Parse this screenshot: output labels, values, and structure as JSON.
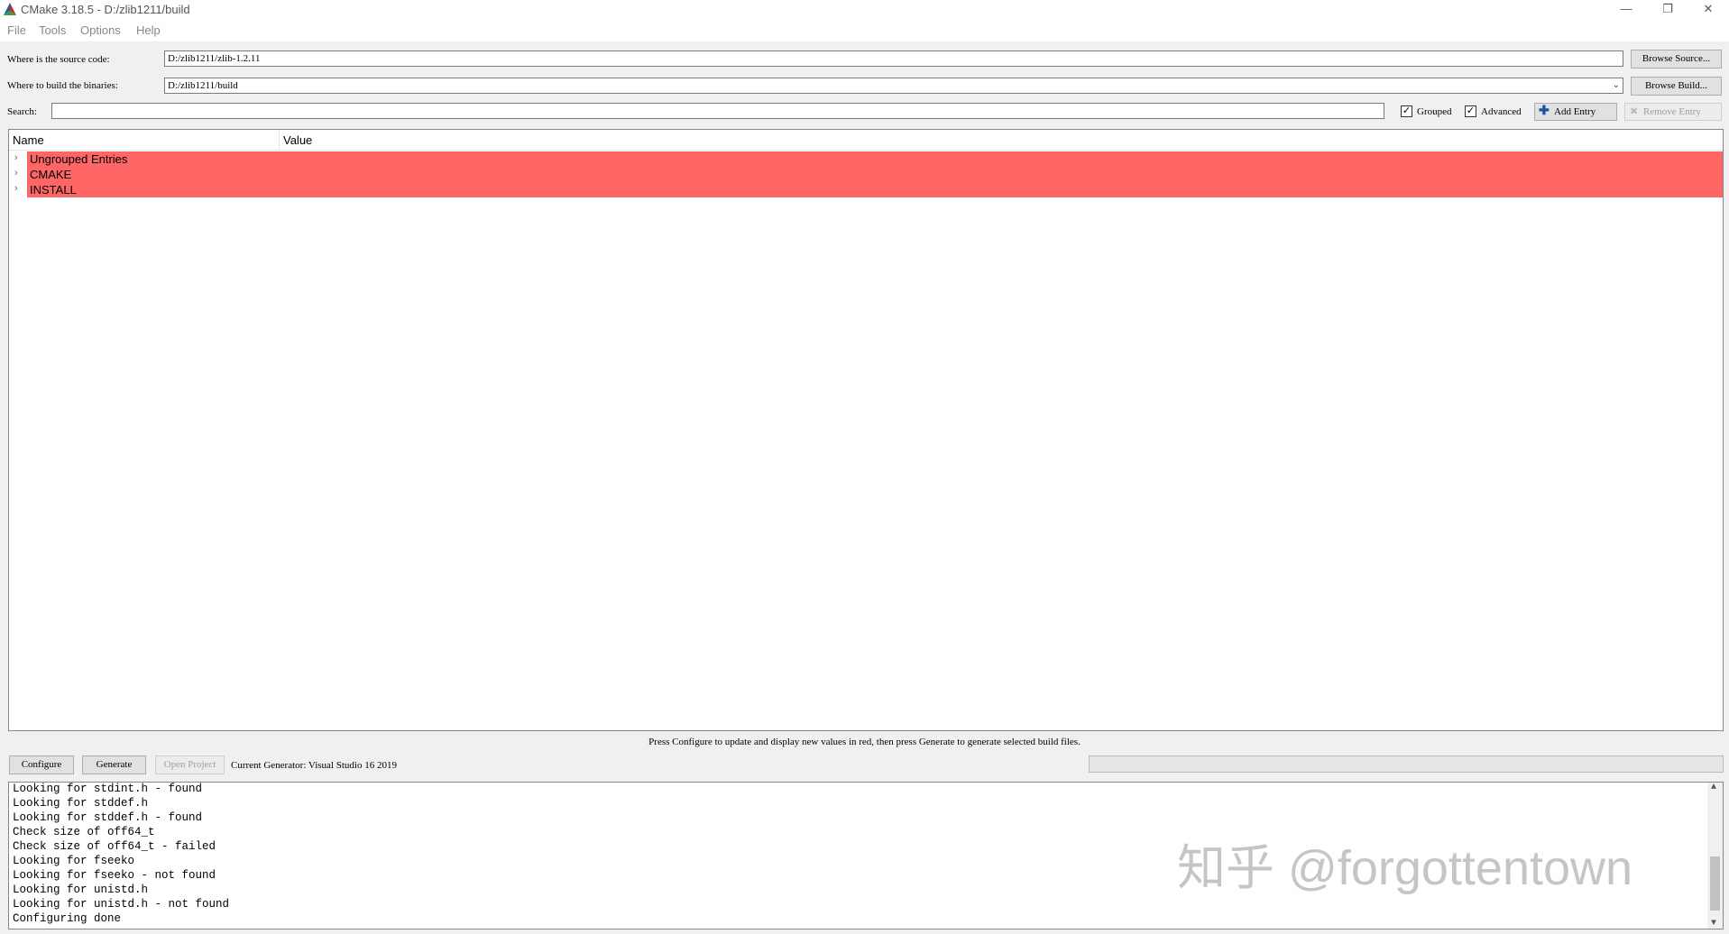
{
  "window": {
    "title": "CMake 3.18.5 - D:/zlib1211/build",
    "minimize": "—",
    "restore": "❐",
    "close": "✕"
  },
  "menu": [
    "File",
    "Tools",
    "Options",
    "Help"
  ],
  "source": {
    "label": "Where is the source code:",
    "value": "D:/zlib1211/zlib-1.2.11",
    "button": "Browse Source..."
  },
  "build": {
    "label": "Where to build the binaries:",
    "value": "D:/zlib1211/build",
    "button": "Browse Build..."
  },
  "search": {
    "label": "Search:",
    "value": ""
  },
  "options": {
    "grouped_label": "Grouped",
    "grouped_checked": true,
    "advanced_label": "Advanced",
    "advanced_checked": true,
    "add_entry": "Add Entry",
    "remove_entry": "Remove Entry"
  },
  "tree": {
    "columns": [
      "Name",
      "Value"
    ],
    "rows": [
      "Ungrouped Entries",
      "CMAKE",
      "INSTALL"
    ],
    "row_color": "#ff6666"
  },
  "hint": "Press Configure to update and display new values in red,  then press Generate to generate selected build files.",
  "actions": {
    "configure": "Configure",
    "generate": "Generate",
    "open_project": "Open Project",
    "generator": "Current Generator: Visual Studio 16 2019"
  },
  "log": [
    "Looking for stdint.h - found",
    "Looking for stddef.h",
    "Looking for stddef.h - found",
    "Check size of off64_t",
    "Check size of off64_t - failed",
    "Looking for fseeko",
    "Looking for fseeko - not found",
    "Looking for unistd.h",
    "Looking for unistd.h - not found",
    "Configuring done"
  ],
  "watermark": "知乎 @forgottentown"
}
